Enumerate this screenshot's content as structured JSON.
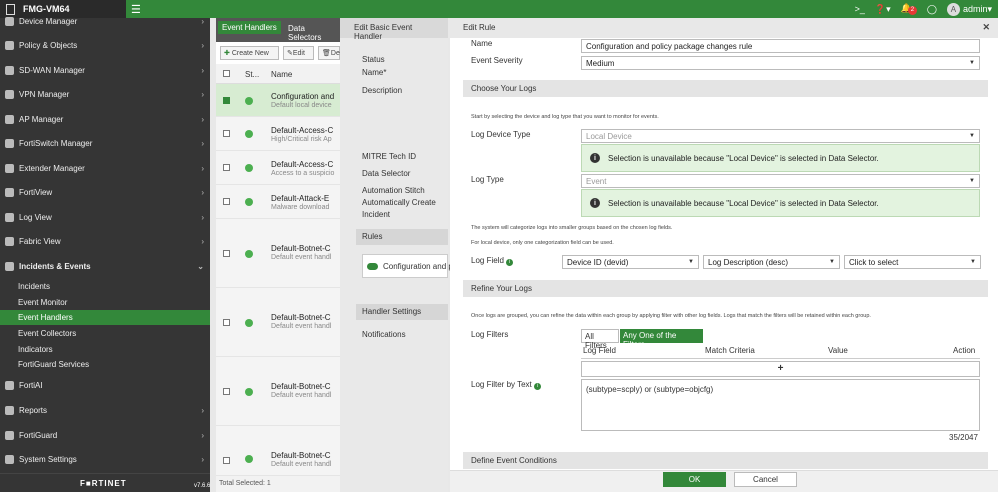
{
  "topbar": {
    "device_name": "FMG-VM64",
    "notif_count": "2",
    "avatar_letter": "A",
    "user": "admin"
  },
  "sidebar": {
    "items": [
      {
        "label": "Device Manager"
      },
      {
        "label": "Policy & Objects"
      },
      {
        "label": "SD-WAN Manager"
      },
      {
        "label": "VPN Manager"
      },
      {
        "label": "AP Manager"
      },
      {
        "label": "FortiSwitch Manager"
      },
      {
        "label": "Extender Manager"
      },
      {
        "label": "FortiView"
      },
      {
        "label": "Log View"
      },
      {
        "label": "Fabric View"
      },
      {
        "label": "Incidents & Events"
      }
    ],
    "sub_items": [
      "Incidents",
      "Event Monitor",
      "Event Handlers",
      "Event Collectors",
      "Indicators",
      "FortiGuard Services"
    ],
    "bottom_items": [
      {
        "label": "FortiAI"
      },
      {
        "label": "Reports"
      },
      {
        "label": "FortiGuard"
      },
      {
        "label": "System Settings"
      }
    ],
    "brand": "F■RTINET",
    "version": "v7.6.6"
  },
  "list": {
    "tabs": [
      "Event Handlers",
      "Data Selectors"
    ],
    "create_new": "Create New",
    "edit": "Edit",
    "delete": "De",
    "col_status": "St...",
    "col_name": "Name",
    "rows": [
      {
        "name": "Configuration and",
        "desc": "Default local device"
      },
      {
        "name": "Default-Access-C",
        "desc": "High/Critical risk Ap"
      },
      {
        "name": "Default-Access-C",
        "desc": "Access to a suspicio"
      },
      {
        "name": "Default-Attack-E",
        "desc": "Malware download"
      },
      {
        "name": "Default-Botnet-C",
        "desc": "Default event handl"
      },
      {
        "name": "Default-Botnet-C",
        "desc": "Default event handl"
      },
      {
        "name": "Default-Botnet-C",
        "desc": "Default event handl"
      },
      {
        "name": "Default-Botnet-C",
        "desc": "Default event handl"
      }
    ],
    "footer": "Total Selected: 1"
  },
  "basic_handler": {
    "title": "Edit Basic Event Handler",
    "status": "Status",
    "name": "Name*",
    "description": "Description",
    "mitre": "MITRE Tech ID",
    "data_selector": "Data Selector",
    "automation": "Automation Stitch",
    "auto_create": "Automatically Create",
    "incident": "Incident",
    "rules": "Rules",
    "rule_item": "Configuration and p",
    "handler_settings": "Handler Settings",
    "notifications": "Notifications"
  },
  "edit_rule": {
    "title": "Edit Rule",
    "name_label": "Name",
    "name_value": "Configuration and policy package changes rule",
    "severity_label": "Event Severity",
    "severity_value": "Medium",
    "choose_logs": "Choose Your Logs",
    "choose_hint": "Start by selecting the device and log type that you want to monitor for events.",
    "device_type_label": "Log Device Type",
    "device_type_value": "Local Device",
    "info_msg": "Selection is unavailable because \"Local Device\" is selected in Data Selector.",
    "log_type_label": "Log Type",
    "log_type_value": "Event",
    "cat_hint1": "The system will categorize logs into smaller groups based on the chosen log fields.",
    "cat_hint2": "For local device, only one categorization field can be used.",
    "log_field_label": "Log Field",
    "field1": "Device ID (devid)",
    "field2": "Log Description (desc)",
    "field3": "Click to select",
    "refine": "Refine Your Logs",
    "refine_hint": "Once logs are grouped, you can refine the data within each group by applying filter with other log fields. Logs that match the filters will be retained within each group.",
    "filters_label": "Log Filters",
    "all_filters": "All Filters",
    "any_filter": "Any One of the Filters",
    "col_field": "Log Field",
    "col_match": "Match Criteria",
    "col_value": "Value",
    "col_action": "Action",
    "add": "+",
    "filter_text_label": "Log Filter by Text",
    "filter_text": "(subtype=scply) or (subtype=objcfg)",
    "counter": "35/2047",
    "define": "Define Event Conditions",
    "ok": "OK",
    "cancel": "Cancel"
  }
}
